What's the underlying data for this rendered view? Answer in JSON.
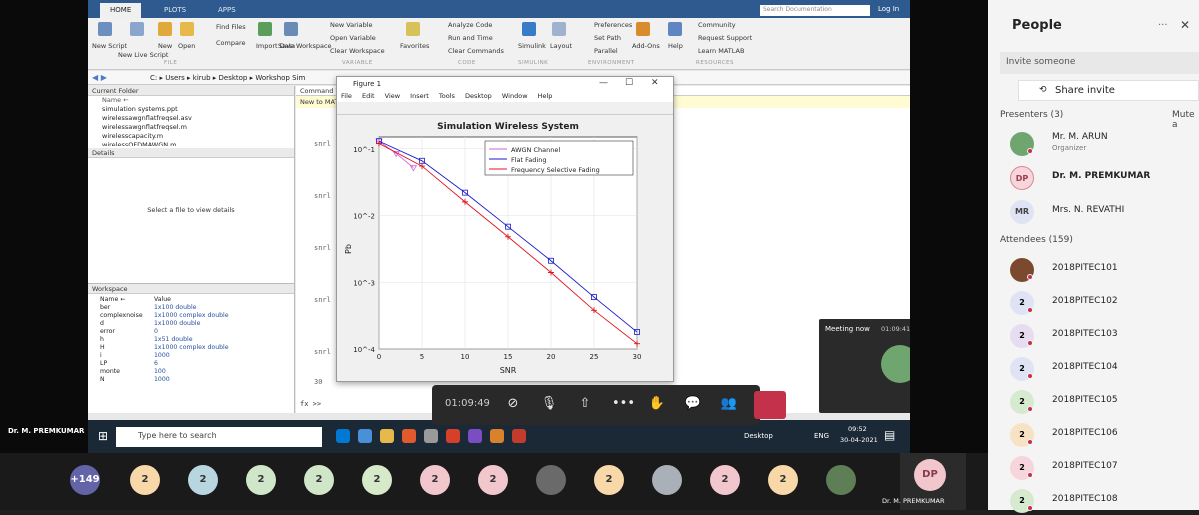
{
  "matlab": {
    "tabs": [
      "HOME",
      "PLOTS",
      "APPS"
    ],
    "search_placeholder": "Search Documentation",
    "login": "Log In",
    "ribbon_items": [
      {
        "label": "New\nScript",
        "x": 8
      },
      {
        "label": "New\nLive Script",
        "x": 32
      },
      {
        "label": "New",
        "x": 66
      },
      {
        "label": "Open",
        "x": 88
      },
      {
        "label": "Find Files",
        "x": 120
      },
      {
        "label": "Compare",
        "x": 120
      },
      {
        "label": "Import\nData",
        "x": 166
      },
      {
        "label": "Save\nWorkspace",
        "x": 190
      },
      {
        "label": "New Variable",
        "x": 242
      },
      {
        "label": "Open Variable",
        "x": 242
      },
      {
        "label": "Clear Workspace",
        "x": 242
      },
      {
        "label": "Favorites",
        "x": 314
      },
      {
        "label": "Analyze Code",
        "x": 354
      },
      {
        "label": "Run and Time",
        "x": 354
      },
      {
        "label": "Clear Commands",
        "x": 354
      },
      {
        "label": "Simulink",
        "x": 430
      },
      {
        "label": "Layout",
        "x": 462
      },
      {
        "label": "Preferences",
        "x": 500
      },
      {
        "label": "Set Path",
        "x": 500
      },
      {
        "label": "Parallel",
        "x": 500
      },
      {
        "label": "Add-Ons",
        "x": 546
      },
      {
        "label": "Help",
        "x": 578
      },
      {
        "label": "Community",
        "x": 606
      },
      {
        "label": "Request Support",
        "x": 606
      },
      {
        "label": "Learn MATLAB",
        "x": 606
      }
    ],
    "sections": [
      "FILE",
      "VARIABLE",
      "CODE",
      "SIMULINK",
      "ENVIRONMENT",
      "RESOURCES"
    ],
    "address": "C: ▸ Users ▸ kirub ▸ Desktop ▸ Workshop Sim",
    "current_folder": {
      "title": "Current Folder",
      "column": "Name ←",
      "files": [
        "simulation systems.ppt",
        "wirelessawgnflatfreqsel.asv",
        "wirelessawgnflatfreqsel.m",
        "wirelesscapacity.m",
        "wirelessOFDMAWGN.m"
      ]
    },
    "details": {
      "title": "Details",
      "message": "Select a file to view details"
    },
    "workspace": {
      "title": "Workspace",
      "cols": [
        "Name ←",
        "Value"
      ],
      "rows": [
        [
          "ber",
          "1x100 double"
        ],
        [
          "complexnoise",
          "1x1000 complex double"
        ],
        [
          "d",
          "1x1000 double"
        ],
        [
          "error",
          "0"
        ],
        [
          "h",
          "1x51 double"
        ],
        [
          "H",
          "1x1000 complex double"
        ],
        [
          "i",
          "1000"
        ],
        [
          "LP",
          "6"
        ],
        [
          "monte",
          "100"
        ],
        [
          "N",
          "1000"
        ]
      ]
    },
    "command": {
      "title": "Command Window",
      "new_to": "New to MATLAB?",
      "lines": [
        "snrl",
        "snrl",
        "snrl",
        "snrl",
        "snrl",
        "snrl"
      ],
      "last": "30",
      "prompt": "fx >>"
    }
  },
  "figure": {
    "title": "Figure 1",
    "menu": [
      "File",
      "Edit",
      "View",
      "Insert",
      "Tools",
      "Desktop",
      "Window",
      "Help"
    ],
    "colors": {
      "awgn": "#d266d2",
      "flat": "#1a1acc",
      "freq": "#e0141e"
    }
  },
  "chart_data": {
    "type": "line",
    "title": "Simulation Wireless System",
    "xlabel": "SNR",
    "ylabel": "Pb",
    "xlim": [
      0,
      30
    ],
    "ylim": [
      0.0001,
      0.15
    ],
    "yscale": "log",
    "xticks": [
      0,
      5,
      10,
      15,
      20,
      25,
      30
    ],
    "ytick_labels": [
      "10^-1",
      "10^-2",
      "10^-3",
      "10^-4"
    ],
    "legend_position": "top-right",
    "grid": true,
    "series": [
      {
        "name": "AWGN Channel",
        "marker": "triangle",
        "x": [
          0,
          2,
          4
        ],
        "y": [
          0.13,
          0.085,
          0.052
        ]
      },
      {
        "name": "Flat Fading",
        "marker": "square",
        "x": [
          0,
          5,
          10,
          15,
          20,
          25,
          30
        ],
        "y": [
          0.13,
          0.066,
          0.022,
          0.0068,
          0.0021,
          0.0006,
          0.00018
        ]
      },
      {
        "name": "Frequency Selective Fading",
        "marker": "plus",
        "x": [
          0,
          5,
          10,
          15,
          20,
          25,
          30
        ],
        "y": [
          0.12,
          0.055,
          0.016,
          0.0048,
          0.0014,
          0.00038,
          0.00012
        ]
      }
    ]
  },
  "taskbar": {
    "search": "Type here to search",
    "desktop": "Desktop",
    "lang": "ENG",
    "time": "09:52",
    "date": "30-04-2021"
  },
  "call": {
    "timer": "01:09:49",
    "meeting_now": "Meeting now",
    "meeting_timer": "01:09:41",
    "presenter": "Dr. M. PREMKUMAR"
  },
  "gallery": {
    "overflow": "+149",
    "count_label": "2",
    "self_initials": "DP",
    "self_name": "Dr. M. PREMKUMAR"
  },
  "people": {
    "title": "People",
    "invite_placeholder": "Invite someone",
    "share_invite": "Share invite",
    "presenters_label": "Presenters (3)",
    "mute_all": "Mute a",
    "presenters": [
      {
        "name": "Mr. M. ARUN",
        "role": "Organizer",
        "initials": "",
        "bold": false
      },
      {
        "name": "Dr. M. PREMKUMAR",
        "role": "",
        "initials": "DP",
        "bold": true
      },
      {
        "name": "Mrs. N. REVATHI",
        "role": "",
        "initials": "MR",
        "bold": false
      }
    ],
    "attendees_label": "Attendees (159)",
    "attendees": [
      "2018PITEC101",
      "2018PITEC102",
      "2018PITEC103",
      "2018PITEC104",
      "2018PITEC105",
      "2018PITEC106",
      "2018PITEC107",
      "2018PITEC108"
    ]
  }
}
